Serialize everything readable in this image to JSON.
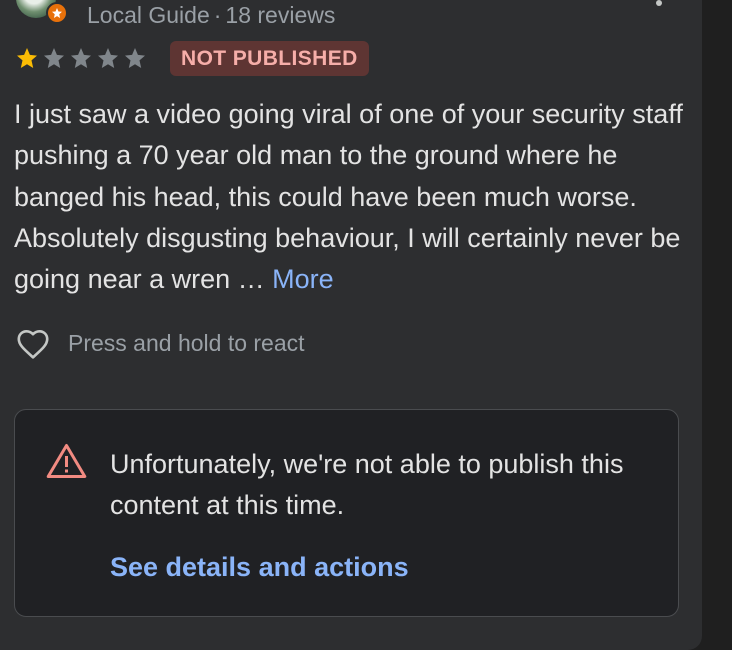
{
  "reviewer": {
    "role": "Local Guide",
    "separator": "·",
    "review_count": "18 reviews",
    "avatar_icon": "profile-photo",
    "badge_icon": "local-guide-badge-icon"
  },
  "rating": {
    "value": 1,
    "max": 5,
    "filled_color": "#fbbc04",
    "empty_color": "#80868b"
  },
  "status_badge": {
    "label": "NOT PUBLISHED",
    "text_color": "#f6aea9",
    "bg_color": "#5e3533"
  },
  "review": {
    "text": "I just saw a video going viral of one of your security staff pushing a 70 year old man to the ground where he banged his head, this could have been much worse. Absolutely disgusting behaviour, I will certainly never be going near a wren …",
    "more_label": "More"
  },
  "react": {
    "icon": "heart-outline-icon",
    "label": "Press and hold to react"
  },
  "notice": {
    "icon": "warning-triangle-icon",
    "message": "Unfortunately, we're not able to publish this content at this time.",
    "action_label": "See details and actions",
    "warning_color": "#f28b82",
    "link_color": "#8ab4f8"
  },
  "menu": {
    "icon": "more-vert-icon"
  }
}
